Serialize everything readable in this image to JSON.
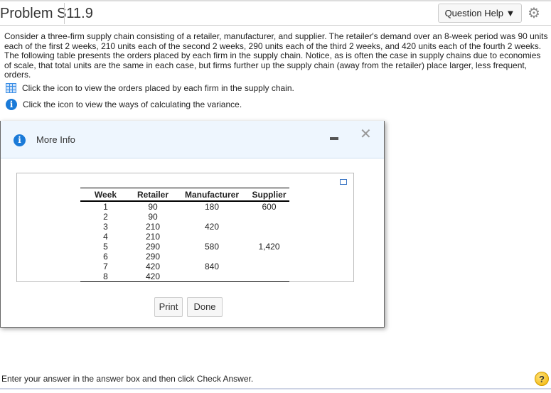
{
  "header": {
    "title": "Problem S11.9",
    "question_help": "Question Help ▼",
    "settings_icon": "gear-icon"
  },
  "intro": "Consider a three-firm supply chain consisting of a retailer, manufacturer, and supplier. The retailer's demand over an 8-week period was 90 units each of the first 2 weeks, 210 units each of the second 2 weeks, 290 units each of the third 2 weeks, and 420 units each of the fourth 2 weeks. The following table presents the orders placed by each firm in the supply chain. Notice, as is often the case in supply chains due to economies of scale, that total units are the same in each case, but firms further up the supply chain (away from the retailer) place larger, less frequent, orders.",
  "links": [
    {
      "icon": "table-grid-icon",
      "text": "Click the icon to view the orders placed by each firm in the supply chain."
    },
    {
      "icon": "info-icon",
      "text": "Click the icon to view the ways of calculating the variance."
    }
  ],
  "dialog": {
    "title": "More Info",
    "info_glyph": "i",
    "close_glyph": "✕",
    "table": {
      "headers": [
        "Week",
        "Retailer",
        "Manufacturer",
        "Supplier"
      ],
      "rows": [
        [
          "1",
          "90",
          "180",
          "600"
        ],
        [
          "2",
          "90",
          "",
          ""
        ],
        [
          "3",
          "210",
          "420",
          ""
        ],
        [
          "4",
          "210",
          "",
          ""
        ],
        [
          "5",
          "290",
          "580",
          "1,420"
        ],
        [
          "6",
          "290",
          "",
          ""
        ],
        [
          "7",
          "420",
          "840",
          ""
        ],
        [
          "8",
          "420",
          "",
          ""
        ]
      ]
    },
    "print": "Print",
    "done": "Done"
  },
  "footer": {
    "text": "Enter your answer in the answer box and then click Check Answer.",
    "help_glyph": "?"
  },
  "colors": {
    "accent": "#1a7ad8",
    "dialog_header": "#eef6fe",
    "help": "#f2b400"
  }
}
